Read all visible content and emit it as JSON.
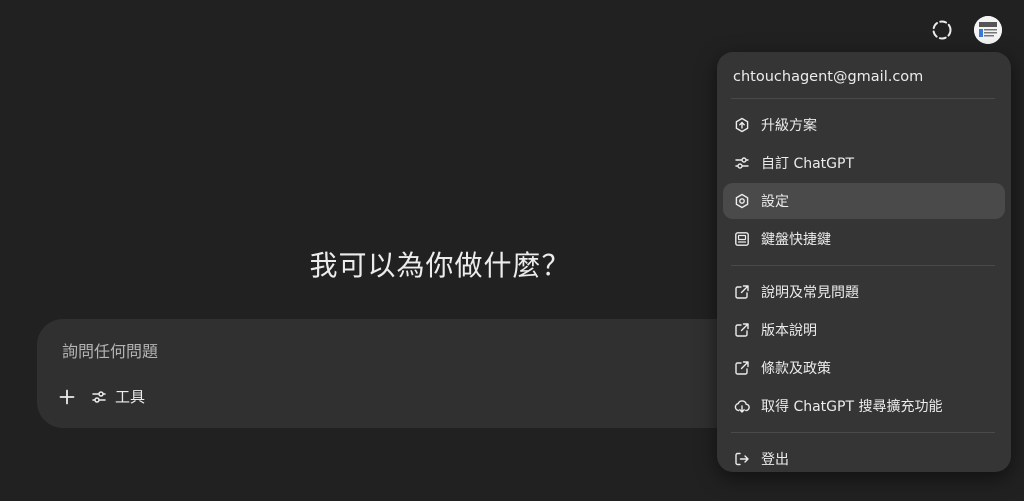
{
  "header": {
    "temp_chat_icon": "dashed-circle-icon",
    "avatar_icon": "avatar"
  },
  "main": {
    "greeting": "我可以為你做什麼？"
  },
  "composer": {
    "placeholder": "詢問任何問題",
    "tools_label": "工具"
  },
  "menu": {
    "email": "chtouchagent@gmail.com",
    "group1": [
      {
        "label": "升級方案",
        "icon": "upgrade-icon"
      },
      {
        "label": "自訂 ChatGPT",
        "icon": "sliders-icon"
      },
      {
        "label": "設定",
        "icon": "gear-icon"
      },
      {
        "label": "鍵盤快捷鍵",
        "icon": "keyboard-icon"
      }
    ],
    "group2": [
      {
        "label": "說明及常見問題",
        "icon": "external-link-icon"
      },
      {
        "label": "版本說明",
        "icon": "external-link-icon"
      },
      {
        "label": "條款及政策",
        "icon": "external-link-icon"
      },
      {
        "label": "取得 ChatGPT 搜尋擴充功能",
        "icon": "extension-icon"
      }
    ],
    "logout": {
      "label": "登出",
      "icon": "logout-icon"
    },
    "active_item": "設定"
  },
  "colors": {
    "background": "#212121",
    "composer": "#303030",
    "menu": "#353535",
    "menu_active": "#4a4a4a",
    "text": "#ececec"
  }
}
